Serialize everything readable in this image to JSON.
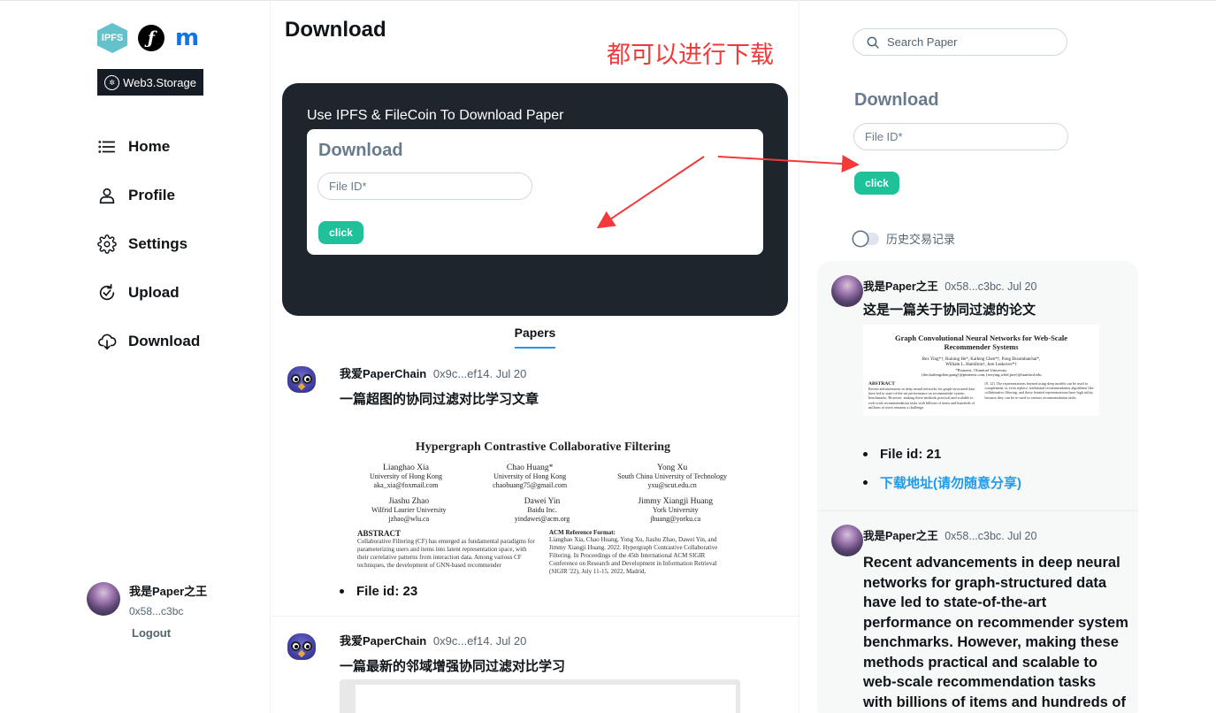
{
  "sidebar": {
    "logos": {
      "ipfs": "IPFS",
      "filecoin": "ƒ",
      "moralis": "m"
    },
    "web3_badge": "Web3.Storage",
    "nav": [
      {
        "label": "Home",
        "icon": "list-icon"
      },
      {
        "label": "Profile",
        "icon": "user-icon"
      },
      {
        "label": "Settings",
        "icon": "gear-icon"
      },
      {
        "label": "Upload",
        "icon": "upload-icon"
      },
      {
        "label": "Download",
        "icon": "cloud-download-icon"
      }
    ],
    "user": {
      "name": "我是Paper之王",
      "address": "0x58...c3bc"
    },
    "logout": "Logout"
  },
  "main": {
    "title": "Download",
    "annotation": "都可以进行下载",
    "card": {
      "heading": "Use IPFS & FileCoin To Download Paper",
      "form_title": "Download",
      "file_id_placeholder": "File ID*",
      "button": "click"
    },
    "tab": "Papers",
    "posts": [
      {
        "author": "我爱PaperChain",
        "meta": "0x9c...ef14. Jul 20",
        "text": "一篇超图的协同过滤对比学习文章",
        "paper": {
          "title": "Hypergraph Contrastive Collaborative Filtering",
          "authors_row1": [
            [
              "Lianghao Xia",
              "University of Hong Kong",
              "aka_xia@foxmail.com"
            ],
            [
              "Chao Huang*",
              "University of Hong Kong",
              "chaohuang75@gmail.com"
            ],
            [
              "Yong Xu",
              "South China University of Technology",
              "yxu@scut.edu.cn"
            ]
          ],
          "authors_row2": [
            [
              "Jiashu Zhao",
              "Wilfrid Laurier University",
              "jzhao@wlu.ca"
            ],
            [
              "Dawei Yin",
              "Baidu Inc.",
              "yindawei@acm.org"
            ],
            [
              "Jimmy Xiangji Huang",
              "York University",
              "jhuang@yorku.ca"
            ]
          ],
          "abstract_heading": "ABSTRACT",
          "abstract_text": "Collaborative Filtering (CF) has emerged as fundamental paradigms for parameterizing users and items into latent representation space, with their correlative patterns from interaction data. Among various CF techniques, the development of GNN-based recommender",
          "ref_heading": "ACM Reference Format:",
          "ref_text": "Lianghao Xia, Chao Huang, Yong Xu, Jiashu Zhao, Dawei Yin, and Jimmy Xiangji Huang. 2022. Hypergraph Contrastive Collaborative Filtering. In Proceedings of the 45th International ACM SIGIR Conference on Research and Development in Information Retrieval (SIGIR '22), July 11-15, 2022, Madrid,"
        },
        "file_id": "File id: 23"
      },
      {
        "author": "我爱PaperChain",
        "meta": "0x9c...ef14. Jul 20",
        "text": "一篇最新的邻域增强协同过滤对比学习"
      }
    ]
  },
  "right": {
    "search_placeholder": "Search Paper",
    "form_title": "Download",
    "file_id_placeholder": "File ID*",
    "button": "click",
    "toggle_label": "历史交易记录",
    "feed": [
      {
        "author": "我是Paper之王",
        "meta": "0x58...c3bc. Jul 20",
        "text": "这是一篇关于协同过滤的论文",
        "paper": {
          "title": "Graph Convolutional Neural Networks for Web-Scale Recommender Systems",
          "authors": "Rex Ying*†, Ruining He*, Kaifeng Chen*†, Pong Eksombatchai*,",
          "authors2": "William L. Hamilton†, Jure Leskovec*†",
          "affil": "*Pinterest, †Stanford University",
          "emails": "{rhe,kaifengchen,pong}@pinterest.com,{rexying,wleif,jure}@stanford.edu",
          "abstract_heading": "ABSTRACT",
          "abstract_text": "Recent advancements in deep neural networks for graph-structured data have led to state-of-the-art performance on recommender system benchmarks. However, making these methods practical and scalable to web-scale recommendation tasks with billions of items and hundreds of millions of users remains a challenge.",
          "right_text": "[9, 12]. The representations learned using deep models can be used to complement, or even replace, traditional recommendation algorithms like collaborative filtering, and these learned representations have high utility because they can be re-used in various recommendation tasks."
        },
        "file_id": "File id: 21",
        "link": "下载地址(请勿随意分享)"
      },
      {
        "author": "我是Paper之王",
        "meta": "0x58...c3bc. Jul 20",
        "text": "Recent advancements in deep neural networks for graph-structured data have led to state-of-the-art performance on recommender system benchmarks. However, making these methods practical and scalable to web-scale recommendation tasks with billions of items and hundreds of"
      }
    ]
  },
  "colors": {
    "accent_green": "#1fc19a",
    "tab_blue": "#1d9bf0",
    "annotation_red": "#f33a3a",
    "dark_card": "#1f252d"
  }
}
